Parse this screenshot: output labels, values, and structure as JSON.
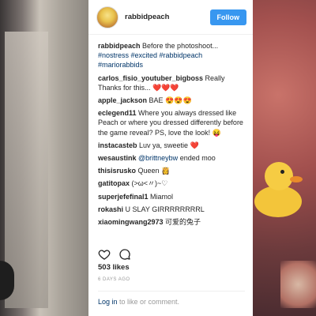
{
  "post": {
    "username": "rabbidpeach",
    "follow_label": "Follow",
    "caption_user": "rabbidpeach",
    "caption_text": "Before the photoshoot...",
    "caption_tags": "#nostress #excited #rabbidpeach #mariorabbids",
    "likes": "503 likes",
    "time": "6 DAYS AGO",
    "login_link": "Log in",
    "login_rest": " to like or comment."
  },
  "comments": [
    {
      "user": "carlos_fisio_youtuber_bigboss",
      "text": " Really Thanks for this... ❤️❤️❤️"
    },
    {
      "user": "apple_jackson",
      "text": " BAE 😍😍😍"
    },
    {
      "user": "eclegend11",
      "text": " Where you always dressed like Peach or where you dressed differently before the game reveal? PS, love the look! 😝"
    },
    {
      "user": "instacasteb",
      "text": " Luv ya, sweetie ❤️"
    },
    {
      "user": "wesaustink",
      "mention": " @brittneybw",
      "text": " ended moo"
    },
    {
      "user": "thisisrusko",
      "text": " Queen 👸"
    },
    {
      "user": "gatitopax",
      "text": " (>ω<〃)~♡"
    },
    {
      "user": "superjefefinal1",
      "text": " Miamol"
    },
    {
      "user": "rokashi",
      "text": " U SLAY GIRRRRRRRRL"
    },
    {
      "user": "xiaomingwang2973",
      "text": " 可爱的兔子"
    }
  ],
  "icons": {
    "like": "heart-icon",
    "comment": "comment-icon"
  },
  "colors": {
    "follow_bg": "#3897f0",
    "tag": "#003569"
  }
}
